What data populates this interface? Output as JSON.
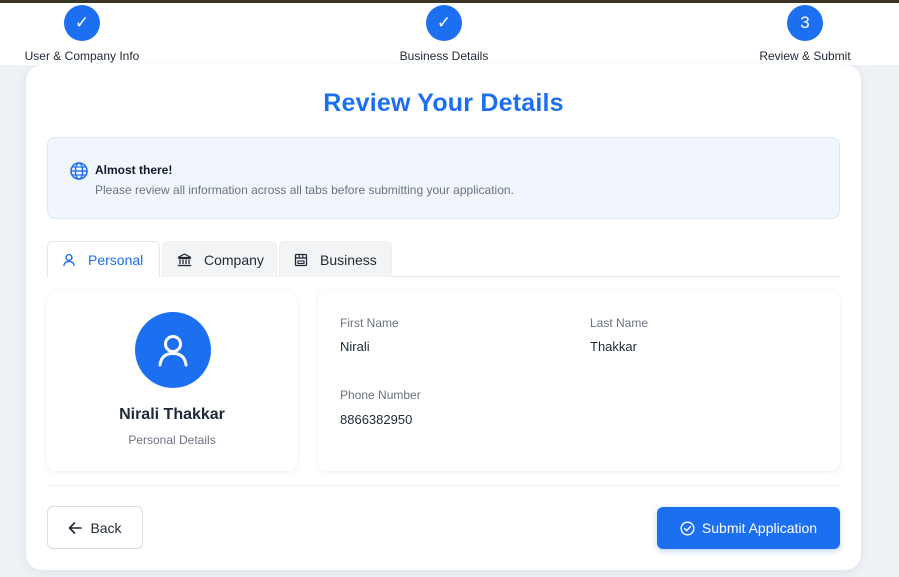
{
  "stepper": {
    "steps": [
      {
        "label": "User & Company Info",
        "marker": "✓",
        "state": "completed"
      },
      {
        "label": "Business Details",
        "marker": "✓",
        "state": "completed"
      },
      {
        "label": "Review & Submit",
        "marker": "3",
        "state": "current"
      }
    ]
  },
  "page": {
    "title": "Review Your Details"
  },
  "notice": {
    "icon": "globe-icon",
    "title": "Almost there!",
    "text": "Please review all information across all tabs before submitting your application."
  },
  "tabs": [
    {
      "label": "Personal",
      "icon": "user-icon",
      "active": true
    },
    {
      "label": "Company",
      "icon": "bank-icon",
      "active": false
    },
    {
      "label": "Business",
      "icon": "store-icon",
      "active": false
    }
  ],
  "profile": {
    "icon": "user-avatar-icon",
    "name": "Nirali Thakkar",
    "subtitle": "Personal Details"
  },
  "details": {
    "first_name_label": "First Name",
    "first_name": "Nirali",
    "last_name_label": "Last Name",
    "last_name": "Thakkar",
    "phone_label": "Phone Number",
    "phone": "8866382950"
  },
  "actions": {
    "back_label": "Back",
    "submit_label": "Submit Application"
  },
  "colors": {
    "accent": "#1d6ff2",
    "notice_bg": "#f1f6fd"
  }
}
